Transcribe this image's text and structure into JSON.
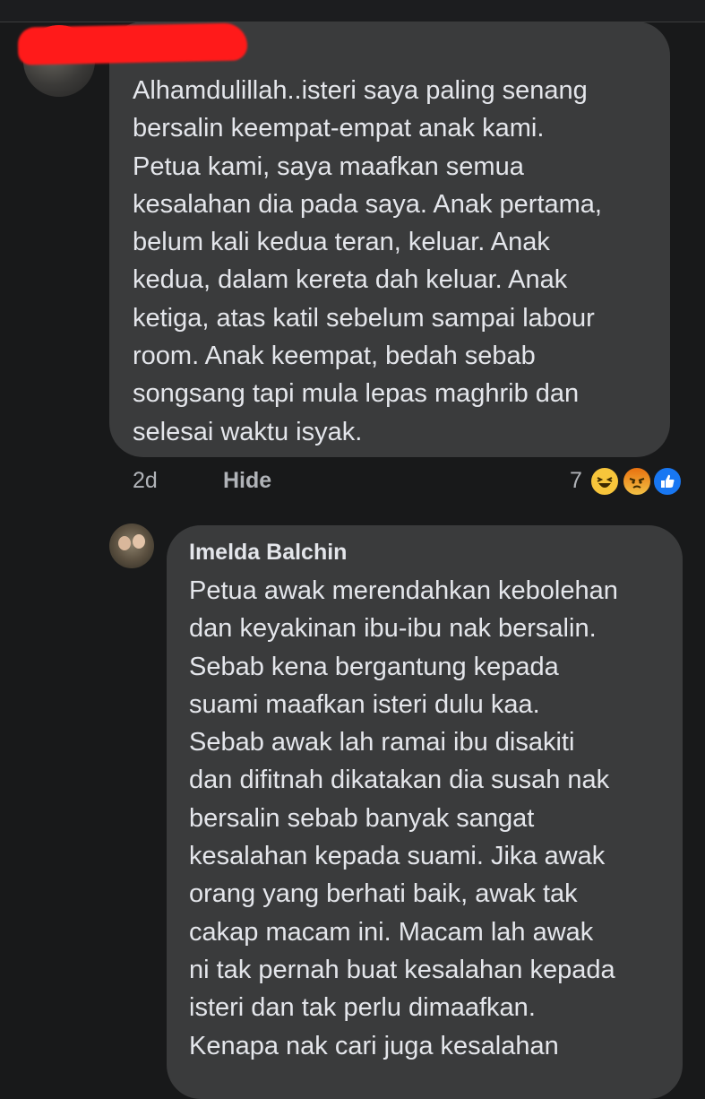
{
  "comment_1": {
    "text": "Alhamdulillah..isteri saya paling senang\nbersalin keempat-empat anak kami.\nPetua kami, saya maafkan semua\nkesalahan dia pada saya. Anak pertama,\nbelum kali kedua teran, keluar. Anak\nkedua, dalam kereta dah keluar. Anak\nketiga, atas katil sebelum sampai labour\nroom. Anak keempat, bedah sebab\nsongsang tapi mula lepas maghrib dan\nselesai waktu isyak.",
    "time": "2d",
    "hide_label": "Hide",
    "reaction_count": "7",
    "reaction_icons": [
      "haha-icon",
      "angry-icon",
      "like-icon"
    ],
    "redacted_color": "#ff1a1a"
  },
  "reply_1": {
    "author": "Imelda Balchin",
    "text": "Petua awak merendahkan kebolehan\ndan keyakinan ibu-ibu nak bersalin.\nSebab kena bergantung kepada\nsuami maafkan isteri dulu kaa.\nSebab awak lah ramai ibu disakiti\ndan difitnah dikatakan dia susah nak\nbersalin sebab banyak sangat\nkesalahan kepada suami. Jika awak\norang yang berhati baik, awak tak\ncakap macam ini. Macam lah awak\nni tak pernah buat kesalahan kepada\nisteri dan tak perlu dimaafkan.\nKenapa nak cari juga kesalahan"
  },
  "colors": {
    "background": "#18191a",
    "bubble": "#3a3b3c",
    "text_primary": "#e4e6eb",
    "text_secondary": "#b0b3b8",
    "like_blue": "#1877f2",
    "haha_yellow": "#f7c53b"
  }
}
